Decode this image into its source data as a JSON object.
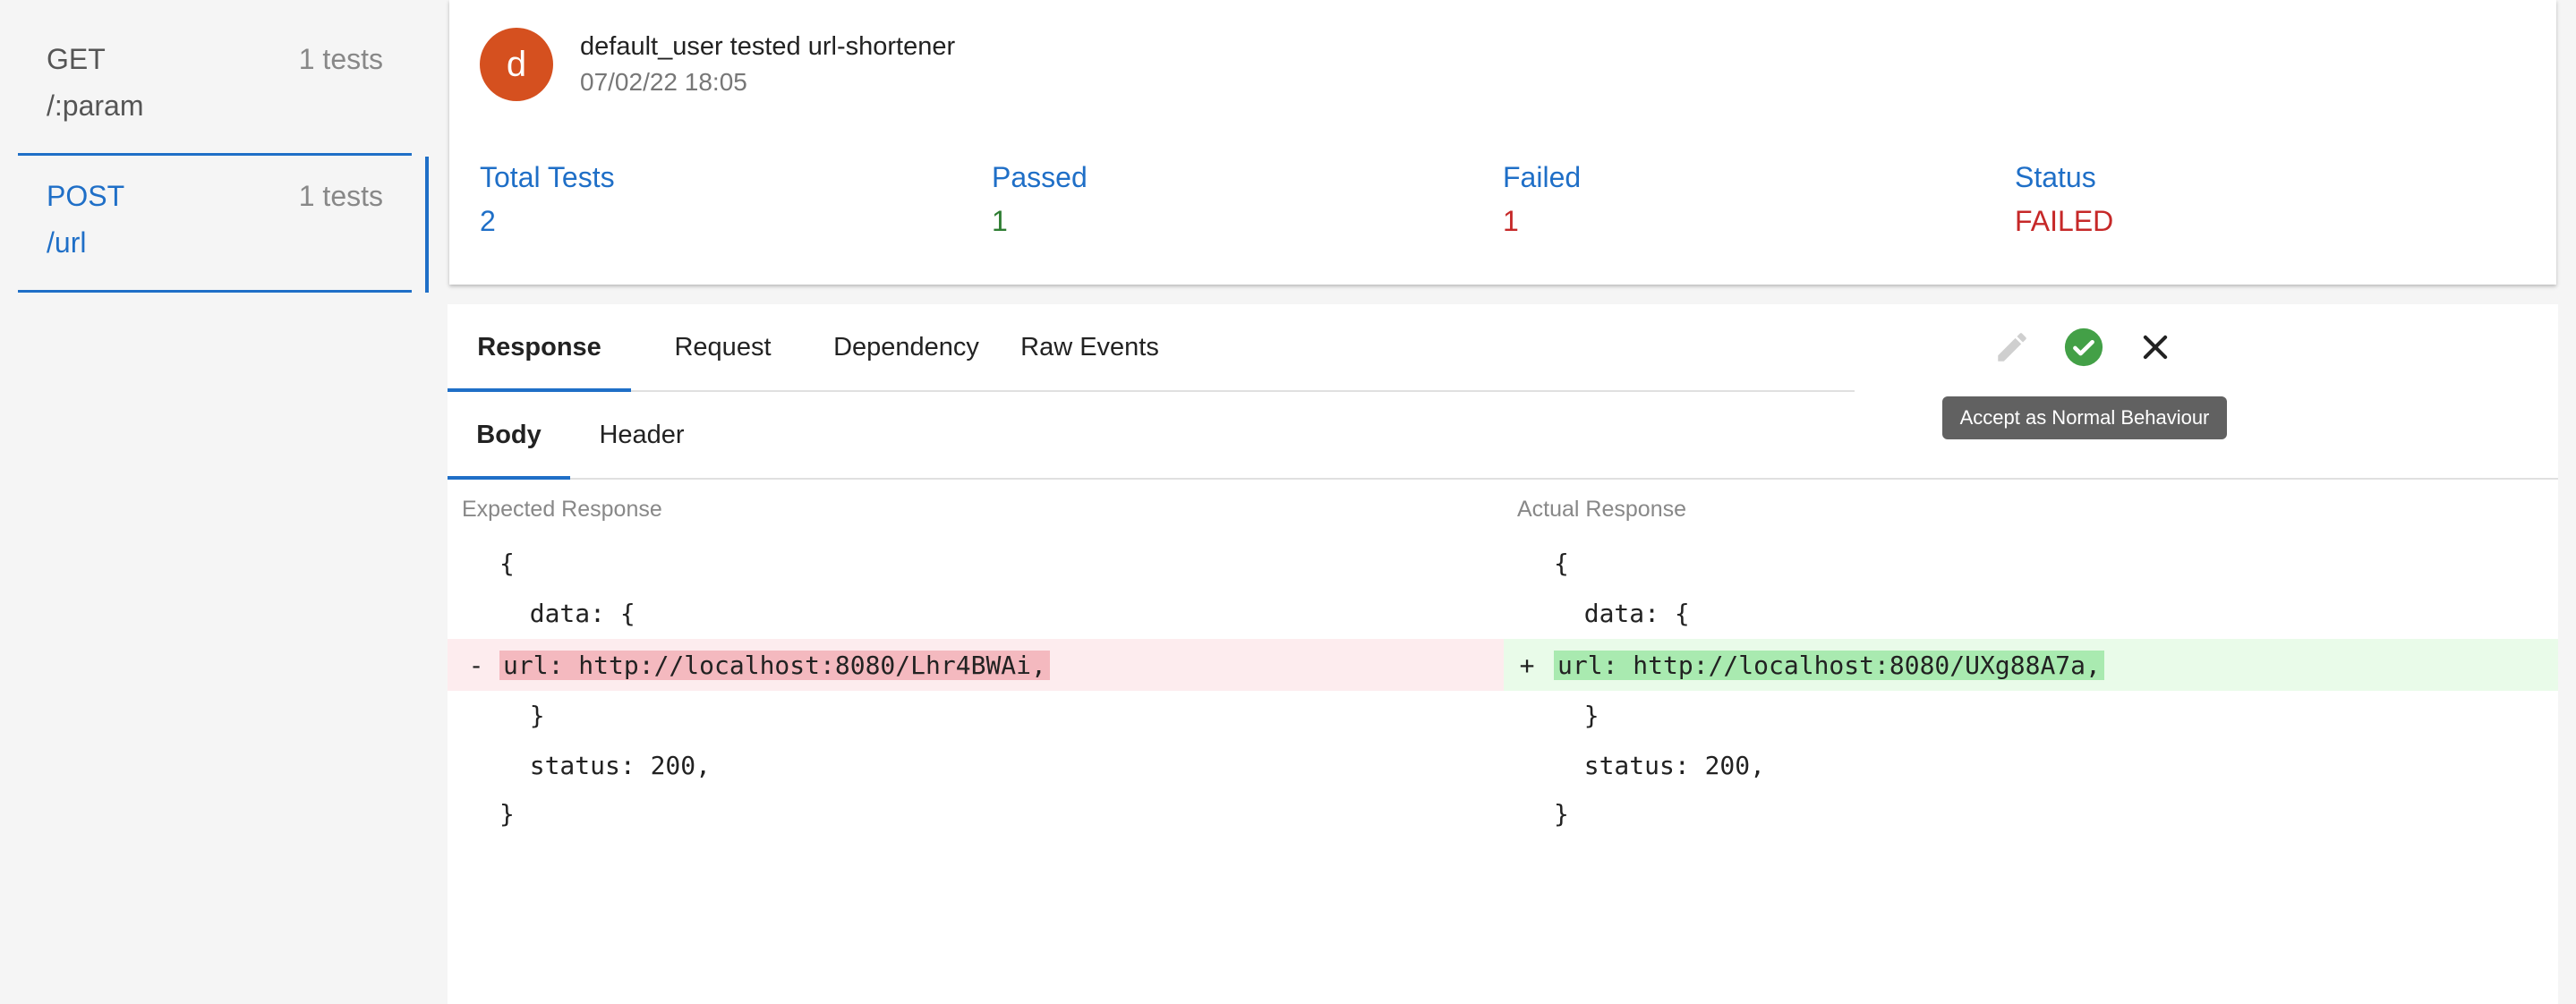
{
  "sidebar": {
    "routes": [
      {
        "method": "GET",
        "path": "/:param",
        "count": "1 tests"
      },
      {
        "method": "POST",
        "path": "/url",
        "count": "1 tests"
      }
    ]
  },
  "summary": {
    "avatar_letter": "d",
    "title": "default_user tested url-shortener",
    "timestamp": "07/02/22 18:05",
    "stats": {
      "total": {
        "label": "Total Tests",
        "value": "2"
      },
      "passed": {
        "label": "Passed",
        "value": "1"
      },
      "failed": {
        "label": "Failed",
        "value": "1"
      },
      "status": {
        "label": "Status",
        "value": "FAILED"
      }
    }
  },
  "tabs": [
    "Response",
    "Request",
    "Dependency",
    "Raw Events"
  ],
  "subtabs": [
    "Body",
    "Header"
  ],
  "actions": {
    "edit_icon": "pencil-icon",
    "accept_icon": "check-circle-icon",
    "reject_icon": "close-icon",
    "tooltip": "Accept as Normal Behaviour"
  },
  "expected": {
    "title": "Expected Response",
    "lines": [
      "{",
      "  data: {",
      "url: http://localhost:8080/Lhr4BWAi,",
      "  }",
      "  status: 200,",
      "}"
    ],
    "diff_mark": "-"
  },
  "actual": {
    "title": "Actual Response",
    "lines": [
      "{",
      "  data: {",
      "url: http://localhost:8080/UXg88A7a,",
      "  }",
      "  status: 200,",
      "}"
    ],
    "diff_mark": "+"
  },
  "colors": {
    "accent": "#1f6fc7",
    "passed": "#2e7d32",
    "failed": "#c62828",
    "avatar": "#d5501f",
    "accept": "#43a047"
  }
}
